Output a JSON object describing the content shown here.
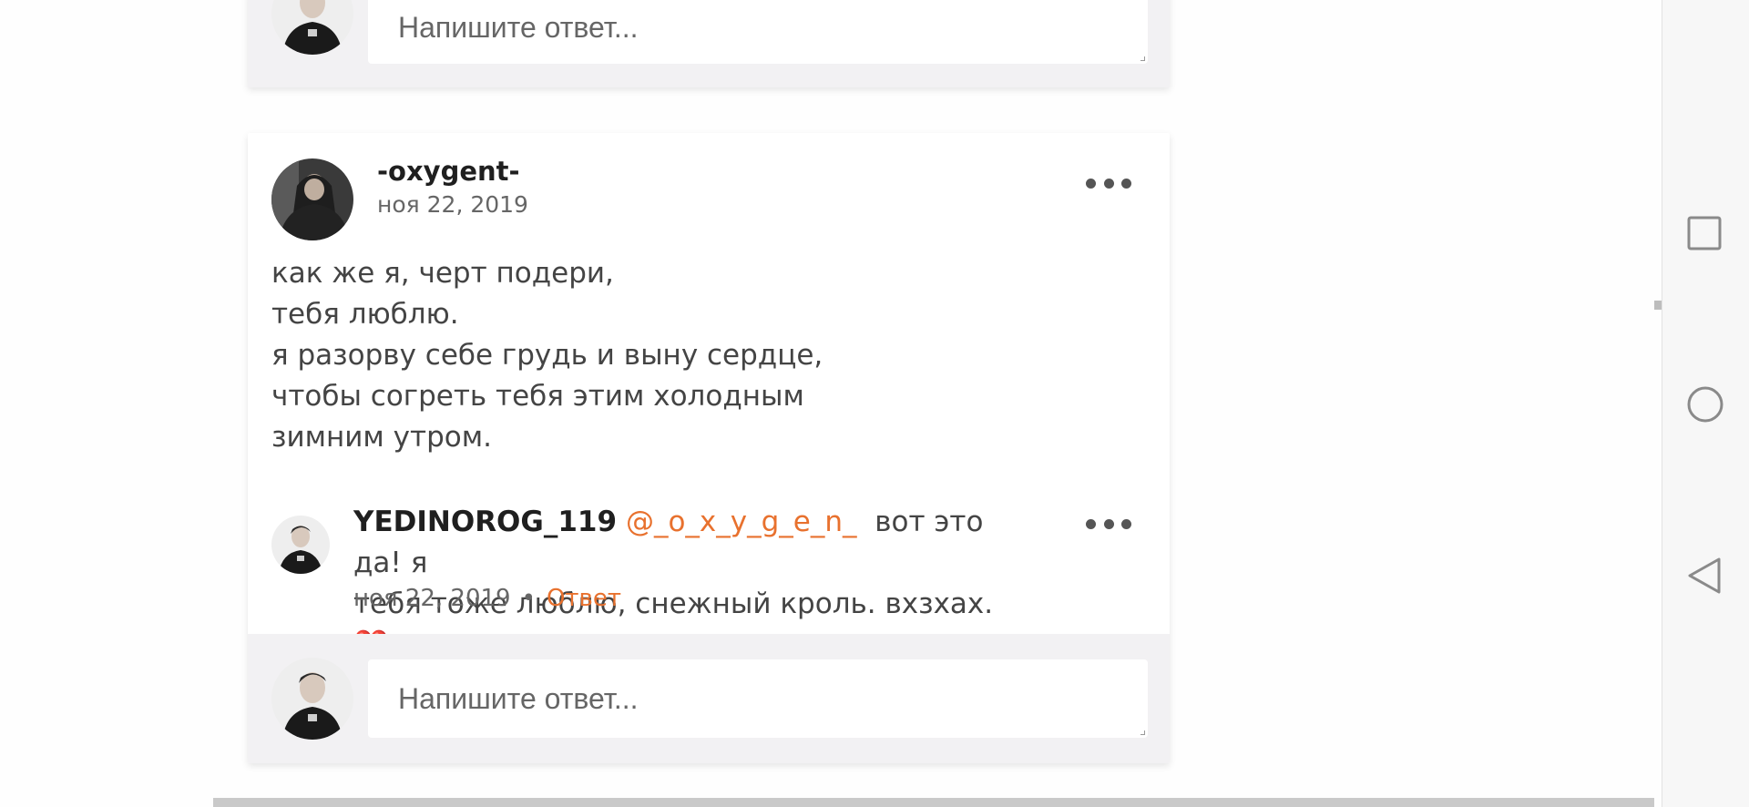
{
  "previous_comment": {
    "reply_placeholder": "Напишите ответ..."
  },
  "post": {
    "author": "-oxygent-",
    "date": "ноя 22, 2019",
    "body_lines": [
      "как же я, черт подери,",
      "тебя люблю.",
      "я разорву себе грудь и выну сердце,",
      "чтобы согреть тебя этим холодным",
      "зимним утром."
    ],
    "comment": {
      "username": "YEDINOROG_119",
      "mention": "@_o_x_y_g_e_n_",
      "text_part1": "вот это да! я",
      "text_part2": "тебя тоже люблю, снежный кроль. вхзхах.",
      "emoji": "❤️",
      "date": "ноя 22, 2019",
      "separator": "•",
      "reply_label": "Ответ"
    },
    "reply_placeholder": "Напишите ответ..."
  },
  "icons": {
    "more": "more-horizontal-icon",
    "nav_recents": "square-icon",
    "nav_home": "circle-icon",
    "nav_back": "triangle-back-icon"
  },
  "colors": {
    "accent": "#e8712e",
    "reply_bar": "#f2f1f3",
    "heart": "#e02020"
  }
}
